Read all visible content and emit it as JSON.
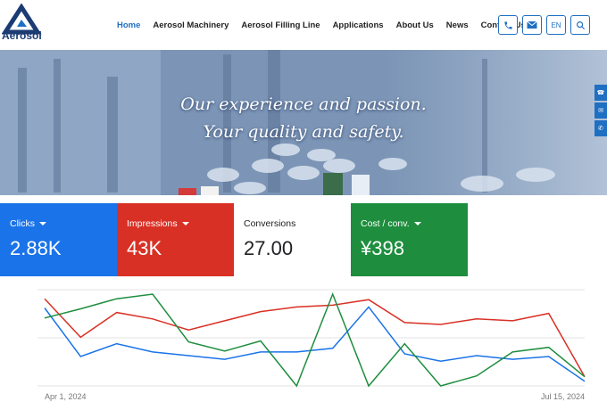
{
  "header": {
    "logo_text": "Aerosol",
    "nav": [
      {
        "label": "Home",
        "active": true
      },
      {
        "label": "Aerosol Machinery",
        "active": false
      },
      {
        "label": "Aerosol Filling Line",
        "active": false
      },
      {
        "label": "Applications",
        "active": false
      },
      {
        "label": "About Us",
        "active": false
      },
      {
        "label": "News",
        "active": false
      },
      {
        "label": "Contact Us",
        "active": false
      }
    ],
    "lang": "EN",
    "icons": [
      "phone-icon",
      "mail-icon",
      "search-icon"
    ],
    "accent": "#1f6fc3"
  },
  "hero": {
    "line1": "Our experience and passion.",
    "line2": "Your quality and safety.",
    "side_icons": [
      "phone-icon",
      "mail-icon",
      "whatsapp-icon"
    ]
  },
  "cards": [
    {
      "label": "Clicks",
      "value": "2.88K",
      "color": "#1a73e8",
      "dropdown": true
    },
    {
      "label": "Impressions",
      "value": "43K",
      "color": "#d93025",
      "dropdown": true
    },
    {
      "label": "Conversions",
      "value": "27.00",
      "color": "#ffffff",
      "dropdown": false
    },
    {
      "label": "Cost / conv.",
      "value": "¥398",
      "color": "#1e8e3e",
      "dropdown": true
    }
  ],
  "chart_data": {
    "type": "line",
    "x_start_label": "Apr 1, 2024",
    "x_end_label": "Jul 15, 2024",
    "grid": true,
    "series": [
      {
        "name": "Clicks",
        "color": "#1a73e8",
        "values": [
          0.85,
          0.32,
          0.46,
          0.37,
          0.33,
          0.29,
          0.37,
          0.37,
          0.41,
          0.86,
          0.35,
          0.27,
          0.33,
          0.29,
          0.32,
          0.05
        ]
      },
      {
        "name": "Impressions",
        "color": "#d93025",
        "values": [
          0.95,
          0.53,
          0.8,
          0.73,
          0.61,
          0.71,
          0.81,
          0.86,
          0.88,
          0.94,
          0.69,
          0.67,
          0.73,
          0.71,
          0.79,
          0.1
        ]
      },
      {
        "name": "Cost / conv.",
        "color": "#1e8e3e",
        "values": [
          0.74,
          0.84,
          0.95,
          1.0,
          0.48,
          0.38,
          0.49,
          0.0,
          1.0,
          0.0,
          0.46,
          0.0,
          0.11,
          0.37,
          0.42,
          0.1
        ]
      }
    ]
  }
}
